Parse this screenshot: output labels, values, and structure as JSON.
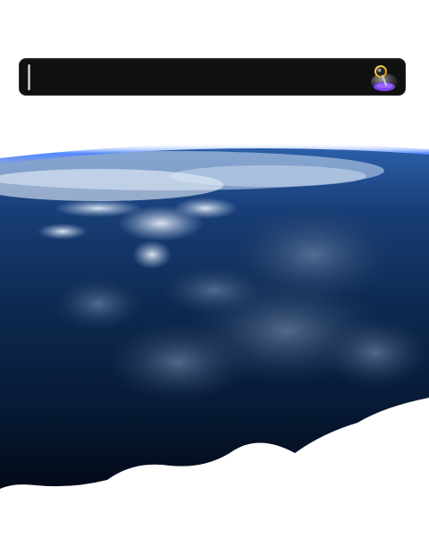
{
  "search": {
    "value": "",
    "placeholder": ""
  },
  "icons": {
    "search_button": "search-pin-icon",
    "background": "earth-orbit-image"
  },
  "colors": {
    "bar_background": "#101010",
    "page_background": "#ffffff",
    "atmosphere": "#2f6cff",
    "icon_accent": "#7a3ff2"
  }
}
